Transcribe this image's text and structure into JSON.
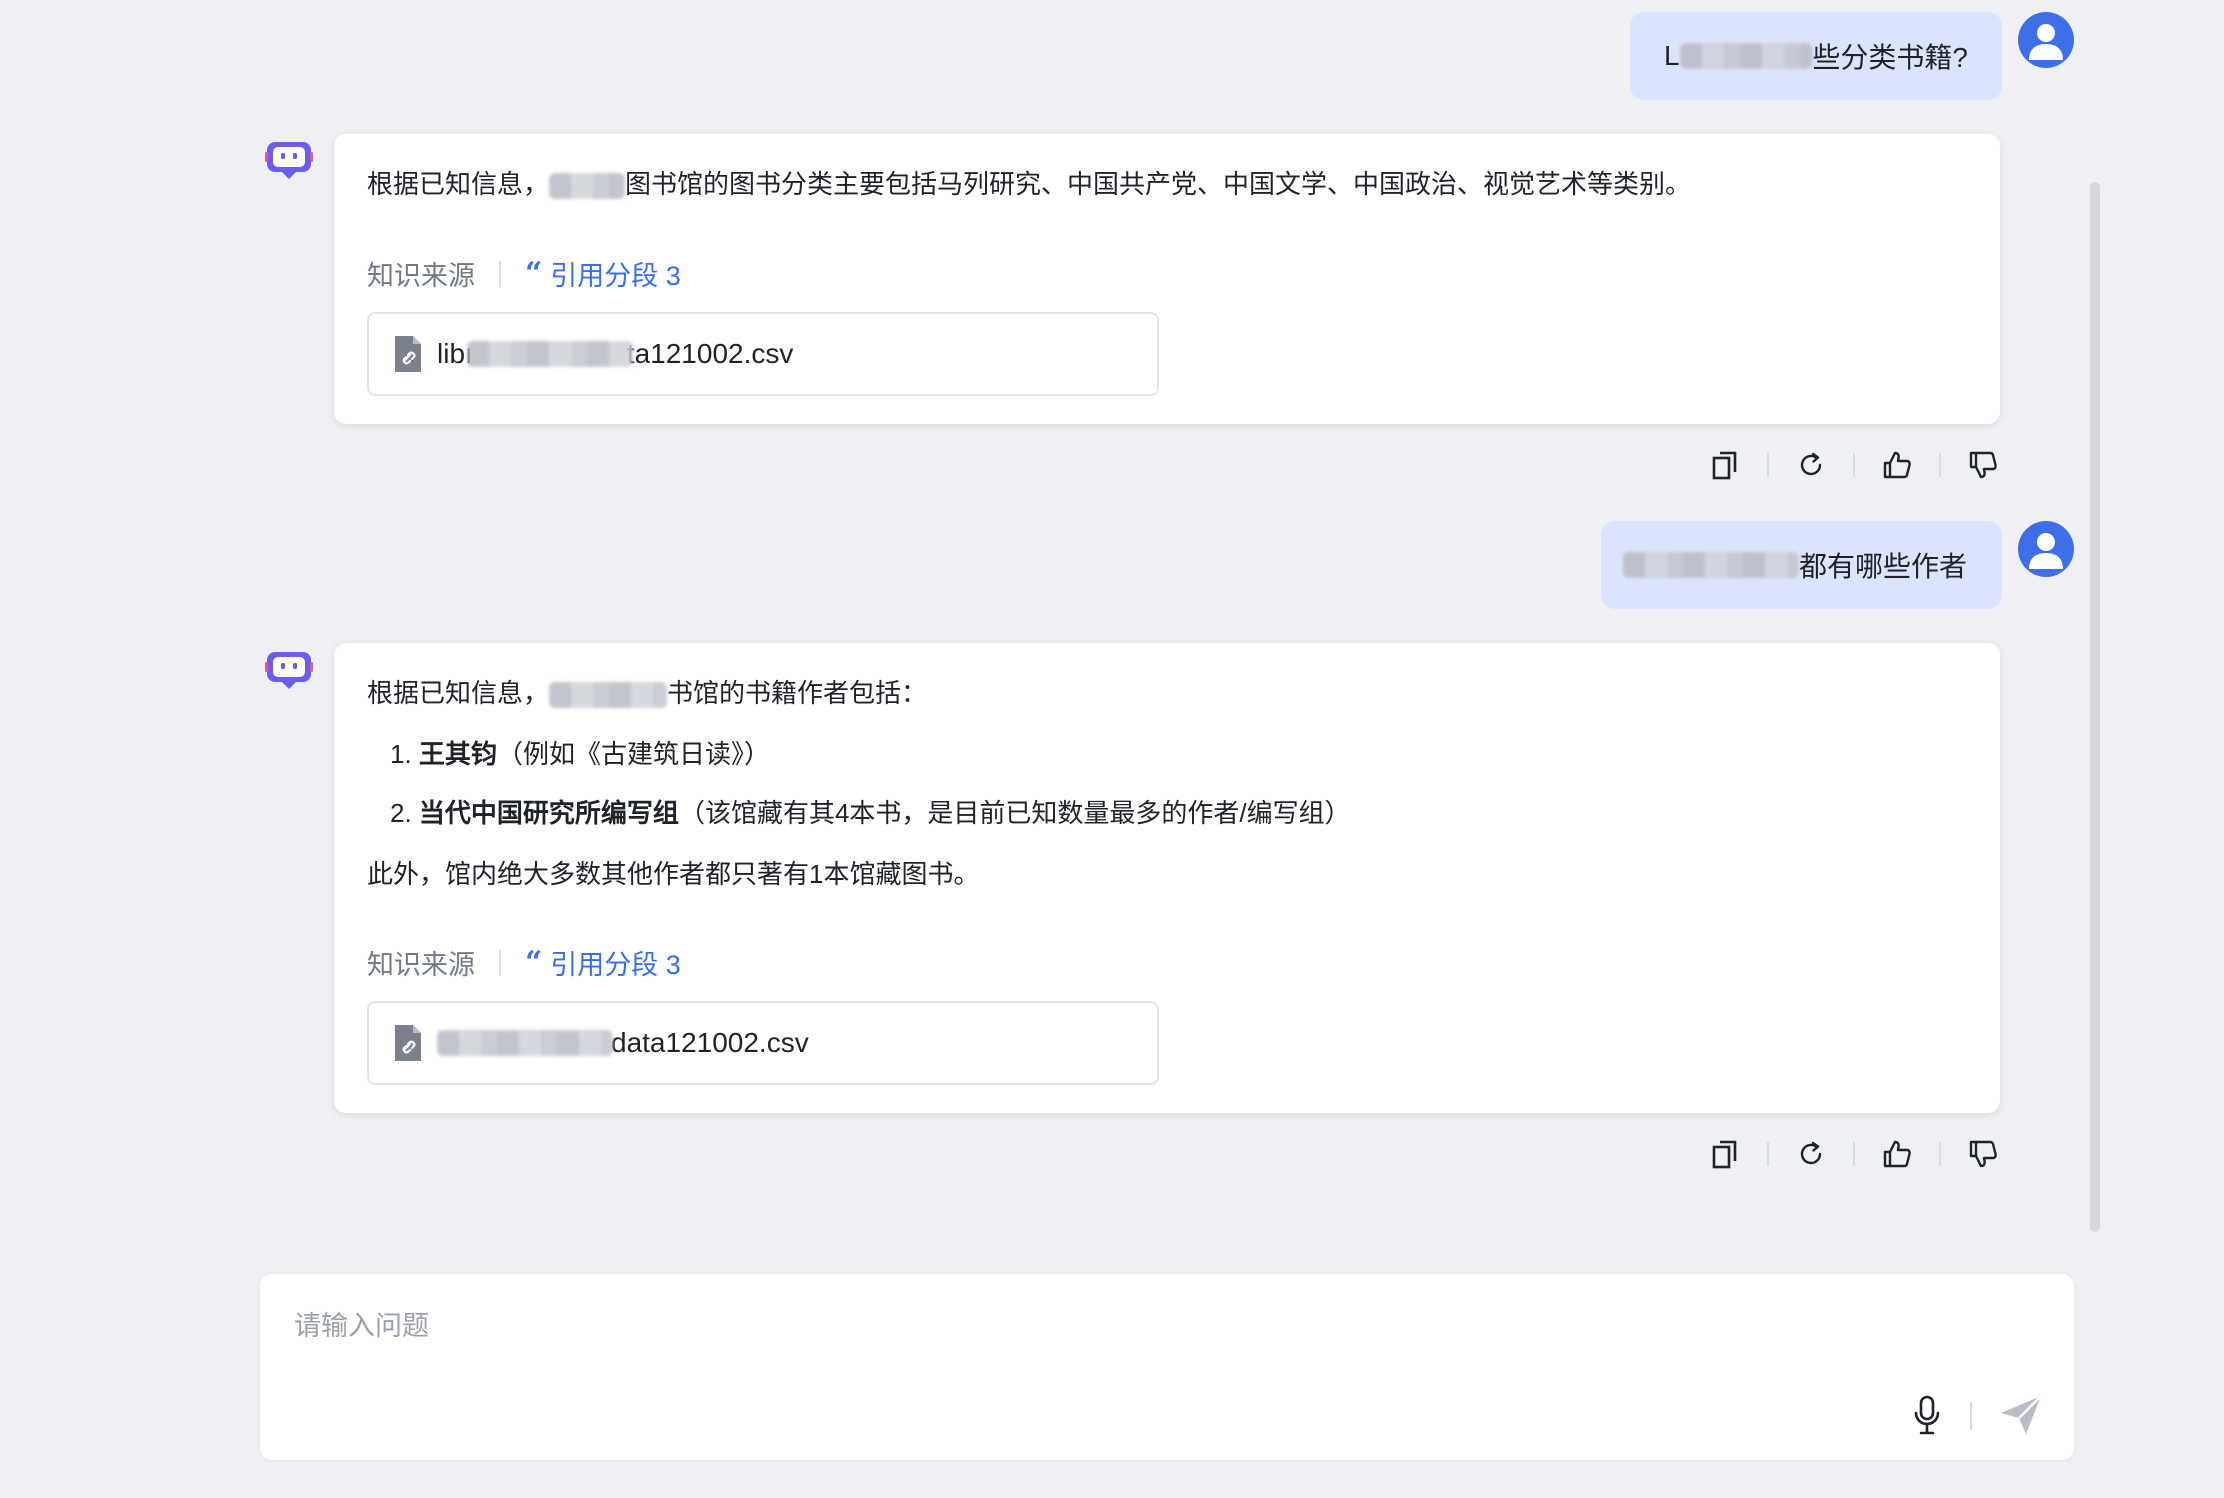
{
  "messages": [
    {
      "role": "user",
      "text_prefix": "L",
      "text_suffix": "些分类书籍?"
    },
    {
      "role": "assistant",
      "text_prefix": "根据已知信息，",
      "text_suffix": "图书馆的图书分类主要包括马列研究、中国共产党、中国文学、中国政治、视觉艺术等类别。",
      "source_label": "知识来源",
      "citation_label": "引用分段 3",
      "file_prefix": "libı",
      "file_suffix": "ta121002.csv"
    },
    {
      "role": "user",
      "text_prefix": "",
      "text_suffix": "都有哪些作者"
    },
    {
      "role": "assistant",
      "text_prefix": "根据已知信息，",
      "text_suffix": "书馆的书籍作者包括：",
      "list": [
        {
          "num": "1.",
          "bold": "王其钧",
          "rest": "（例如《古建筑日读》）"
        },
        {
          "num": "2.",
          "bold": "当代中国研究所编写组",
          "rest": "（该馆藏有其4本书，是目前已知数量最多的作者/编写组）"
        }
      ],
      "closing": "此外，馆内绝大多数其他作者都只著有1本馆藏图书。",
      "source_label": "知识来源",
      "citation_label": "引用分段 3",
      "file_prefix": "",
      "file_suffix": "data121002.csv"
    }
  ],
  "input": {
    "placeholder": "请输入问题",
    "value": ""
  },
  "icons": {
    "copy": "copy-icon",
    "regenerate": "refresh-icon",
    "like": "thumbs-up-icon",
    "dislike": "thumbs-down-icon",
    "mic": "microphone-icon",
    "send": "send-icon",
    "bot": "bot-avatar-icon",
    "user": "user-avatar-icon",
    "file": "file-link-icon"
  },
  "colors": {
    "background": "#eff0f4",
    "user_bubble": "#dce4fd",
    "accent": "#3a6ee8",
    "bot_icon": "#6a5df0",
    "avatar": "#3f6fe8"
  }
}
